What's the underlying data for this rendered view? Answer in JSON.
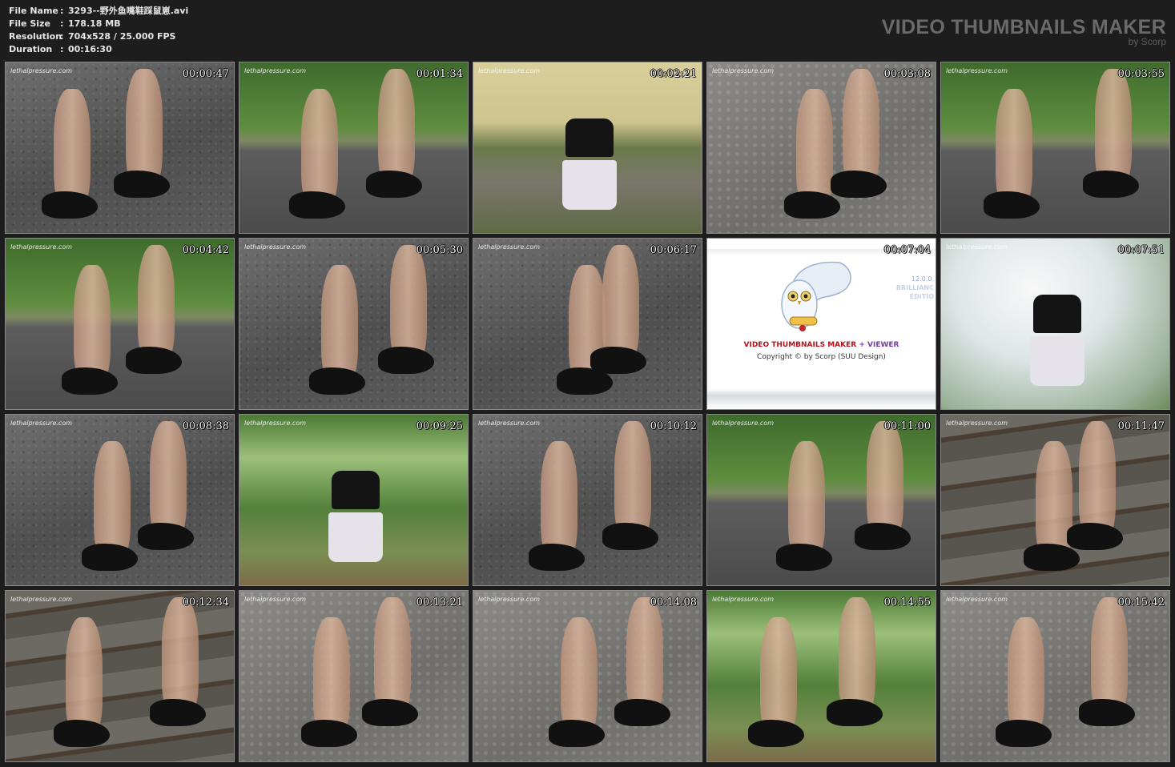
{
  "info": {
    "rows": [
      {
        "label": "File Name",
        "sep": ":",
        "value": "3293--野外鱼嘴鞋踩鼠崽.avi"
      },
      {
        "label": "File Size",
        "sep": ":",
        "value": "178.18 MB"
      },
      {
        "label": "Resolution",
        "sep": ":",
        "value": "704x528 / 25.000 FPS"
      },
      {
        "label": "Duration",
        "sep": ":",
        "value": "00:16:30"
      }
    ]
  },
  "brand": {
    "title": "VIDEO THUMBNAILS MAKER",
    "subtitle": "by Scorp"
  },
  "watermark": "lethalpressure.com",
  "splash": {
    "title_main": "VIDEO THUMBNAILS MAKER",
    "title_plus": " + VIEWER",
    "copyright": "Copyright © by Scorp (SUU Design)",
    "version": "12.0.0.",
    "edition_line1": "BRILLIANC",
    "edition_line2": "EDITIO"
  },
  "thumbnails": [
    {
      "time": "00:00:47",
      "scene": "asphalt"
    },
    {
      "time": "00:01:34",
      "scene": "road-green"
    },
    {
      "time": "00:02:21",
      "scene": "building"
    },
    {
      "time": "00:03:08",
      "scene": "stone"
    },
    {
      "time": "00:03:55",
      "scene": "road-green"
    },
    {
      "time": "00:04:42",
      "scene": "road-green"
    },
    {
      "time": "00:05:30",
      "scene": "asphalt"
    },
    {
      "time": "00:06:17",
      "scene": "asphalt"
    },
    {
      "time": "00:07:04",
      "scene": "splash"
    },
    {
      "time": "00:07:51",
      "scene": "bright"
    },
    {
      "time": "00:08:38",
      "scene": "asphalt"
    },
    {
      "time": "00:09:25",
      "scene": "park"
    },
    {
      "time": "00:10:12",
      "scene": "asphalt"
    },
    {
      "time": "00:11:00",
      "scene": "road-green"
    },
    {
      "time": "00:11:47",
      "scene": "stairs"
    },
    {
      "time": "00:12:34",
      "scene": "stairs"
    },
    {
      "time": "00:13:21",
      "scene": "stone"
    },
    {
      "time": "00:14:08",
      "scene": "stone"
    },
    {
      "time": "00:14:55",
      "scene": "park"
    },
    {
      "time": "00:15:42",
      "scene": "stone"
    }
  ]
}
